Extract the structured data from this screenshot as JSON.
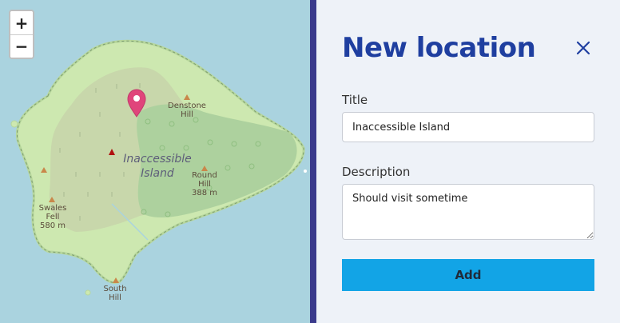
{
  "map": {
    "zoom_in_label": "+",
    "zoom_out_label": "−",
    "island_name_line1": "Inaccessible",
    "island_name_line2": "Island",
    "peaks": [
      {
        "name_line1": "Denstone",
        "name_line2": "Hill",
        "elevation": ""
      },
      {
        "name_line1": "Round",
        "name_line2": "Hill",
        "elevation": "388 m"
      },
      {
        "name_line1": "Swales",
        "name_line2": "Fell",
        "elevation": "580 m"
      },
      {
        "name_line1": "South",
        "name_line2": "Hill",
        "elevation": ""
      }
    ],
    "marker_icon": "map-pin",
    "colors": {
      "water": "#aad3df",
      "land": "#cde8b0",
      "forest": "#add19e",
      "scrub": "#c8d7ab",
      "marker": "#e0457b"
    }
  },
  "panel": {
    "title": "New location",
    "close_icon": "close-x",
    "title_label": "Title",
    "title_value": "Inaccessible Island",
    "description_label": "Description",
    "description_value": "Should visit sometime",
    "add_label": "Add",
    "colors": {
      "title": "#1f3fa0",
      "button": "#12a4e6",
      "divider": "#3a3a8c"
    }
  }
}
